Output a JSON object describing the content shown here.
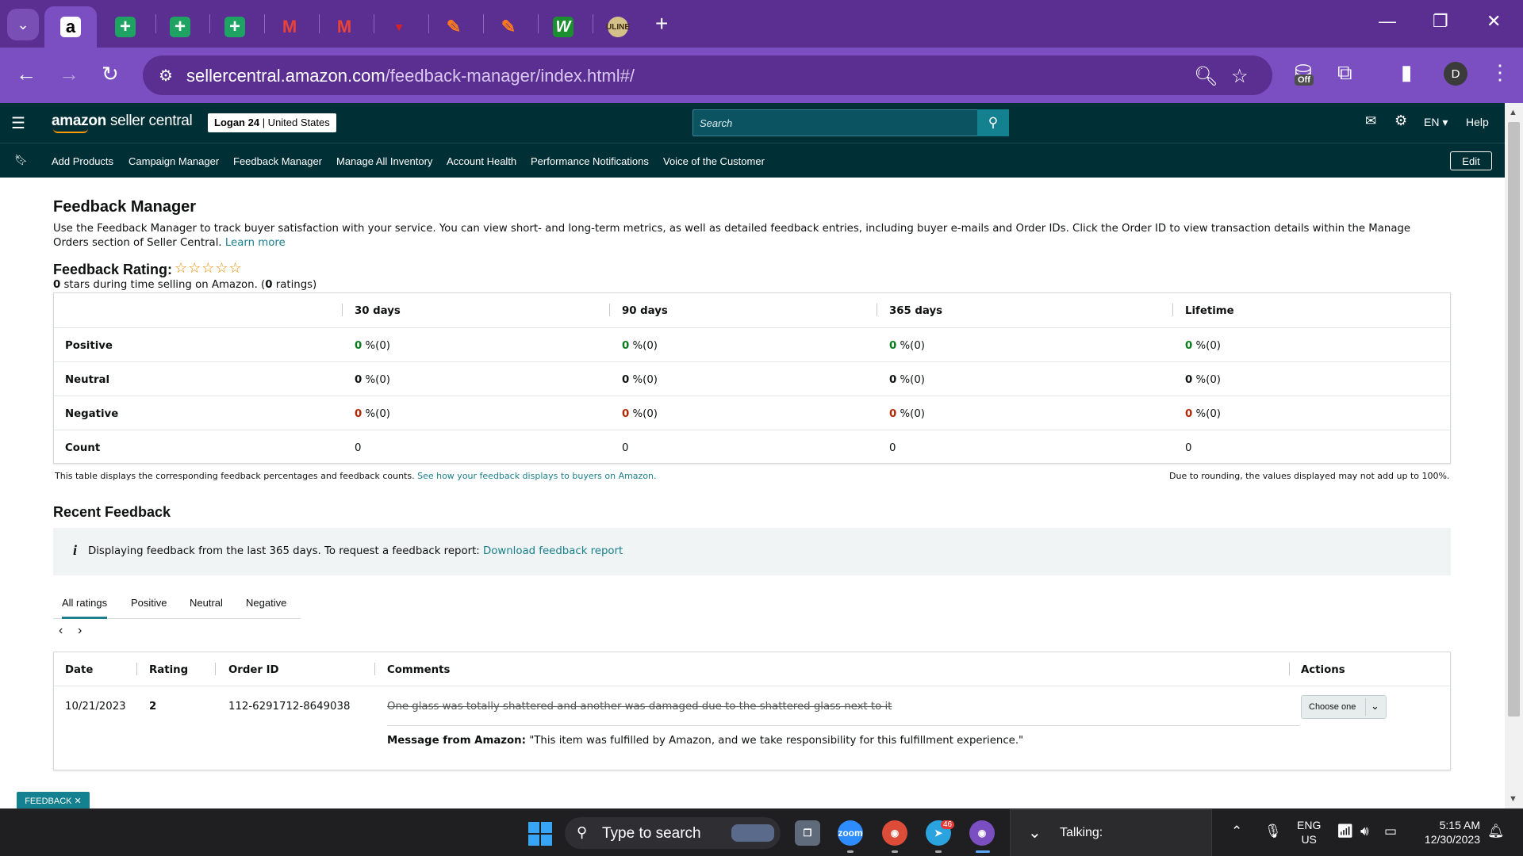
{
  "browser": {
    "tabs": [
      {
        "icon": "amazon-icon",
        "glyph": "a"
      },
      {
        "icon": "sheets-icon",
        "glyph": "+"
      },
      {
        "icon": "sheets-icon",
        "glyph": "+"
      },
      {
        "icon": "sheets-icon",
        "glyph": "+"
      },
      {
        "icon": "gmail-icon",
        "glyph": "M"
      },
      {
        "icon": "gmail-icon",
        "glyph": "M"
      },
      {
        "icon": "red-logo-icon",
        "glyph": "▼"
      },
      {
        "icon": "pen-icon",
        "glyph": "✎"
      },
      {
        "icon": "pen-icon",
        "glyph": "✎"
      },
      {
        "icon": "w-icon",
        "glyph": "W"
      },
      {
        "icon": "uline-icon",
        "glyph": "ULINE"
      }
    ],
    "url_host": "sellercentral.amazon.com",
    "url_path": "/feedback-manager/index.html#/",
    "extension_badge": "Off",
    "profile_initial": "D"
  },
  "header": {
    "logo_bold": "amazon",
    "logo_rest": " seller central",
    "account_name": "Logan 24",
    "account_region": " | United States",
    "search_placeholder": "Search",
    "language": "EN ▾",
    "help": "Help"
  },
  "nav": {
    "items": [
      "Add Products",
      "Campaign Manager",
      "Feedback Manager",
      "Manage All Inventory",
      "Account Health",
      "Performance Notifications",
      "Voice of the Customer"
    ],
    "edit": "Edit"
  },
  "page": {
    "title": "Feedback Manager",
    "intro": "Use the Feedback Manager to track buyer satisfaction with your service. You can view short- and long-term metrics, as well as detailed feedback entries, including buyer e-mails and Order IDs. Click the Order ID to view transaction details within the Manage Orders section of Seller Central. ",
    "learn_more": "Learn more",
    "rating_title": "Feedback Rating:",
    "stars": "☆☆☆☆☆",
    "rating_count_stars": "0",
    "rating_sub_mid": " stars during time selling on Amazon. (",
    "rating_count_ratings": "0",
    "rating_sub_end": " ratings)"
  },
  "metrics": {
    "columns": [
      "30 days",
      "90 days",
      "365 days",
      "Lifetime"
    ],
    "rows": [
      {
        "label": "Positive",
        "cells": [
          {
            "num": "0",
            "rest": " %(0)"
          },
          {
            "num": "0",
            "rest": " %(0)"
          },
          {
            "num": "0",
            "rest": " %(0)"
          },
          {
            "num": "0",
            "rest": " %(0)"
          }
        ]
      },
      {
        "label": "Neutral",
        "cells": [
          {
            "num": "0",
            "rest": " %(0)"
          },
          {
            "num": "0",
            "rest": " %(0)"
          },
          {
            "num": "0",
            "rest": " %(0)"
          },
          {
            "num": "0",
            "rest": " %(0)"
          }
        ]
      },
      {
        "label": "Negative",
        "cells": [
          {
            "num": "0",
            "rest": " %(0)"
          },
          {
            "num": "0",
            "rest": " %(0)"
          },
          {
            "num": "0",
            "rest": " %(0)"
          },
          {
            "num": "0",
            "rest": " %(0)"
          }
        ]
      },
      {
        "label": "Count",
        "cells": [
          {
            "num": "0",
            "rest": ""
          },
          {
            "num": "0",
            "rest": ""
          },
          {
            "num": "0",
            "rest": ""
          },
          {
            "num": "0",
            "rest": ""
          }
        ]
      }
    ],
    "note_left": "This table displays the corresponding feedback percentages and feedback counts. ",
    "note_link": "See how your feedback displays to buyers on Amazon.",
    "note_right": "Due to rounding, the values displayed may not add up to 100%."
  },
  "recent": {
    "title": "Recent Feedback",
    "alert_icon": "i",
    "alert_text": "Displaying feedback from the last 365 days. To request a feedback report: ",
    "alert_link": "Download feedback report",
    "tabs": [
      "All ratings",
      "Positive",
      "Neutral",
      "Negative"
    ],
    "pager_prev": "‹",
    "pager_next": "›",
    "columns": [
      "Date",
      "Rating",
      "Order ID",
      "Comments",
      "Actions"
    ],
    "row": {
      "date": "10/21/2023",
      "rating": "2",
      "order_id": "112-6291712-8649038",
      "comment": "One glass was totally shattered and another was damaged due to the shattered glass next to it",
      "message_label": "Message from Amazon:",
      "message_text": " \"This item was fulfilled by Amazon, and we take responsibility for this fulfillment experience.\"",
      "action": "Choose one"
    }
  },
  "feedback_tab": "FEEDBACK ✕",
  "taskbar": {
    "search_text": "Type to search",
    "telegram_badge": "46",
    "talking": "Talking:",
    "lang_1": "ENG",
    "lang_2": "US",
    "time": "5:15 AM",
    "date": "12/30/2023"
  }
}
